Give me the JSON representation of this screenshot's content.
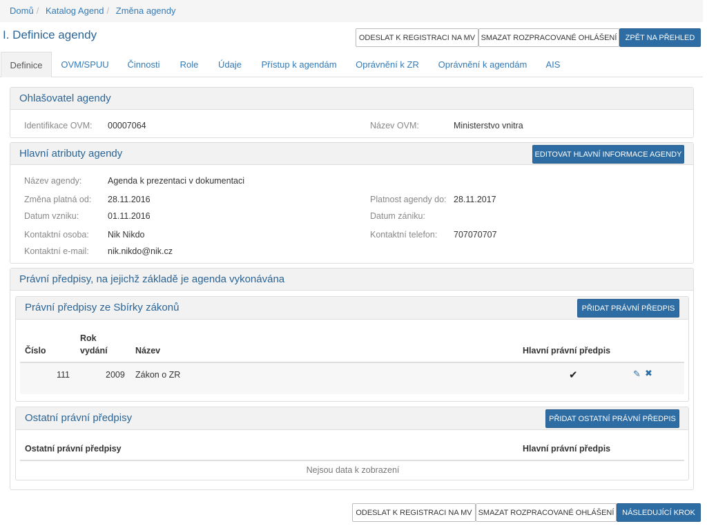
{
  "breadcrumb": {
    "items": [
      "Domů",
      "Katalog Agend",
      "Změna agendy"
    ]
  },
  "page": {
    "title": "I. Definice agendy"
  },
  "top_buttons": {
    "send": "ODESLAT K REGISTRACI NA MV",
    "delete": "SMAZAT ROZPRACOVANÉ OHLÁŠENÍ",
    "back": "ZPĚT NA PŘEHLED"
  },
  "tabs": [
    "Definice",
    "OVM/SPUU",
    "Činnosti",
    "Role",
    "Údaje",
    "Přístup k agendám",
    "Oprávnění k ZR",
    "Oprávnění k agendám",
    "AIS"
  ],
  "announcer": {
    "title": "Ohlašovatel agendy",
    "id_label": "Identifikace OVM:",
    "id_value": "00007064",
    "name_label": "Název OVM:",
    "name_value": "Ministerstvo vnitra"
  },
  "main_attrs": {
    "title": "Hlavní atributy agendy",
    "edit_button": "EDITOVAT HLAVNÍ INFORMACE AGENDY",
    "name_label": "Název agendy:",
    "name_value": "Agenda k prezentaci v dokumentaci",
    "change_label": "Změna platná od:",
    "change_value": "28.11.2016",
    "valid_label": "Platnost agendy do:",
    "valid_value": "28.11.2017",
    "created_label": "Datum vzniku:",
    "created_value": "01.11.2016",
    "end_label": "Datum zániku:",
    "end_value": "",
    "contact_label": "Kontaktní osoba:",
    "contact_value": "Nik Nikdo",
    "phone_label": "Kontaktní telefon:",
    "phone_value": "707070707",
    "email_label": "Kontaktní e-mail:",
    "email_value": "nik.nikdo@nik.cz"
  },
  "legal": {
    "title": "Právní předpisy, na jejichž základě je agenda vykonávána",
    "collection": {
      "title": "Právní předpisy ze Sbírky zákonů",
      "add_button": "PŘIDAT PRÁVNÍ PŘEDPIS",
      "headers": {
        "number": "Číslo",
        "year_line1": "Rok",
        "year_line2": "vydání",
        "name": "Název",
        "main": "Hlavní právní předpis"
      },
      "rows": [
        {
          "number": "111",
          "year": "2009",
          "name": "Zákon o ZR",
          "main_icon": "check-icon"
        }
      ]
    },
    "other": {
      "title": "Ostatní právní předpisy",
      "add_button": "PŘIDAT OSTATNÍ PRÁVNÍ PŘEDPIS",
      "headers": {
        "name": "Ostatní právní předpisy",
        "main": "Hlavní právní předpis"
      },
      "empty": "Nejsou data k zobrazení"
    }
  },
  "bottom_buttons": {
    "send": "ODESLAT K REGISTRACI NA MV",
    "delete": "SMAZAT ROZPRACOVANÉ OHLÁŠENÍ",
    "next": "NÁSLEDUJÍCÍ KROK"
  },
  "colors": {
    "primary": "#2e6da4",
    "link": "#337ab7",
    "panel_head": "#f2f2f2"
  }
}
